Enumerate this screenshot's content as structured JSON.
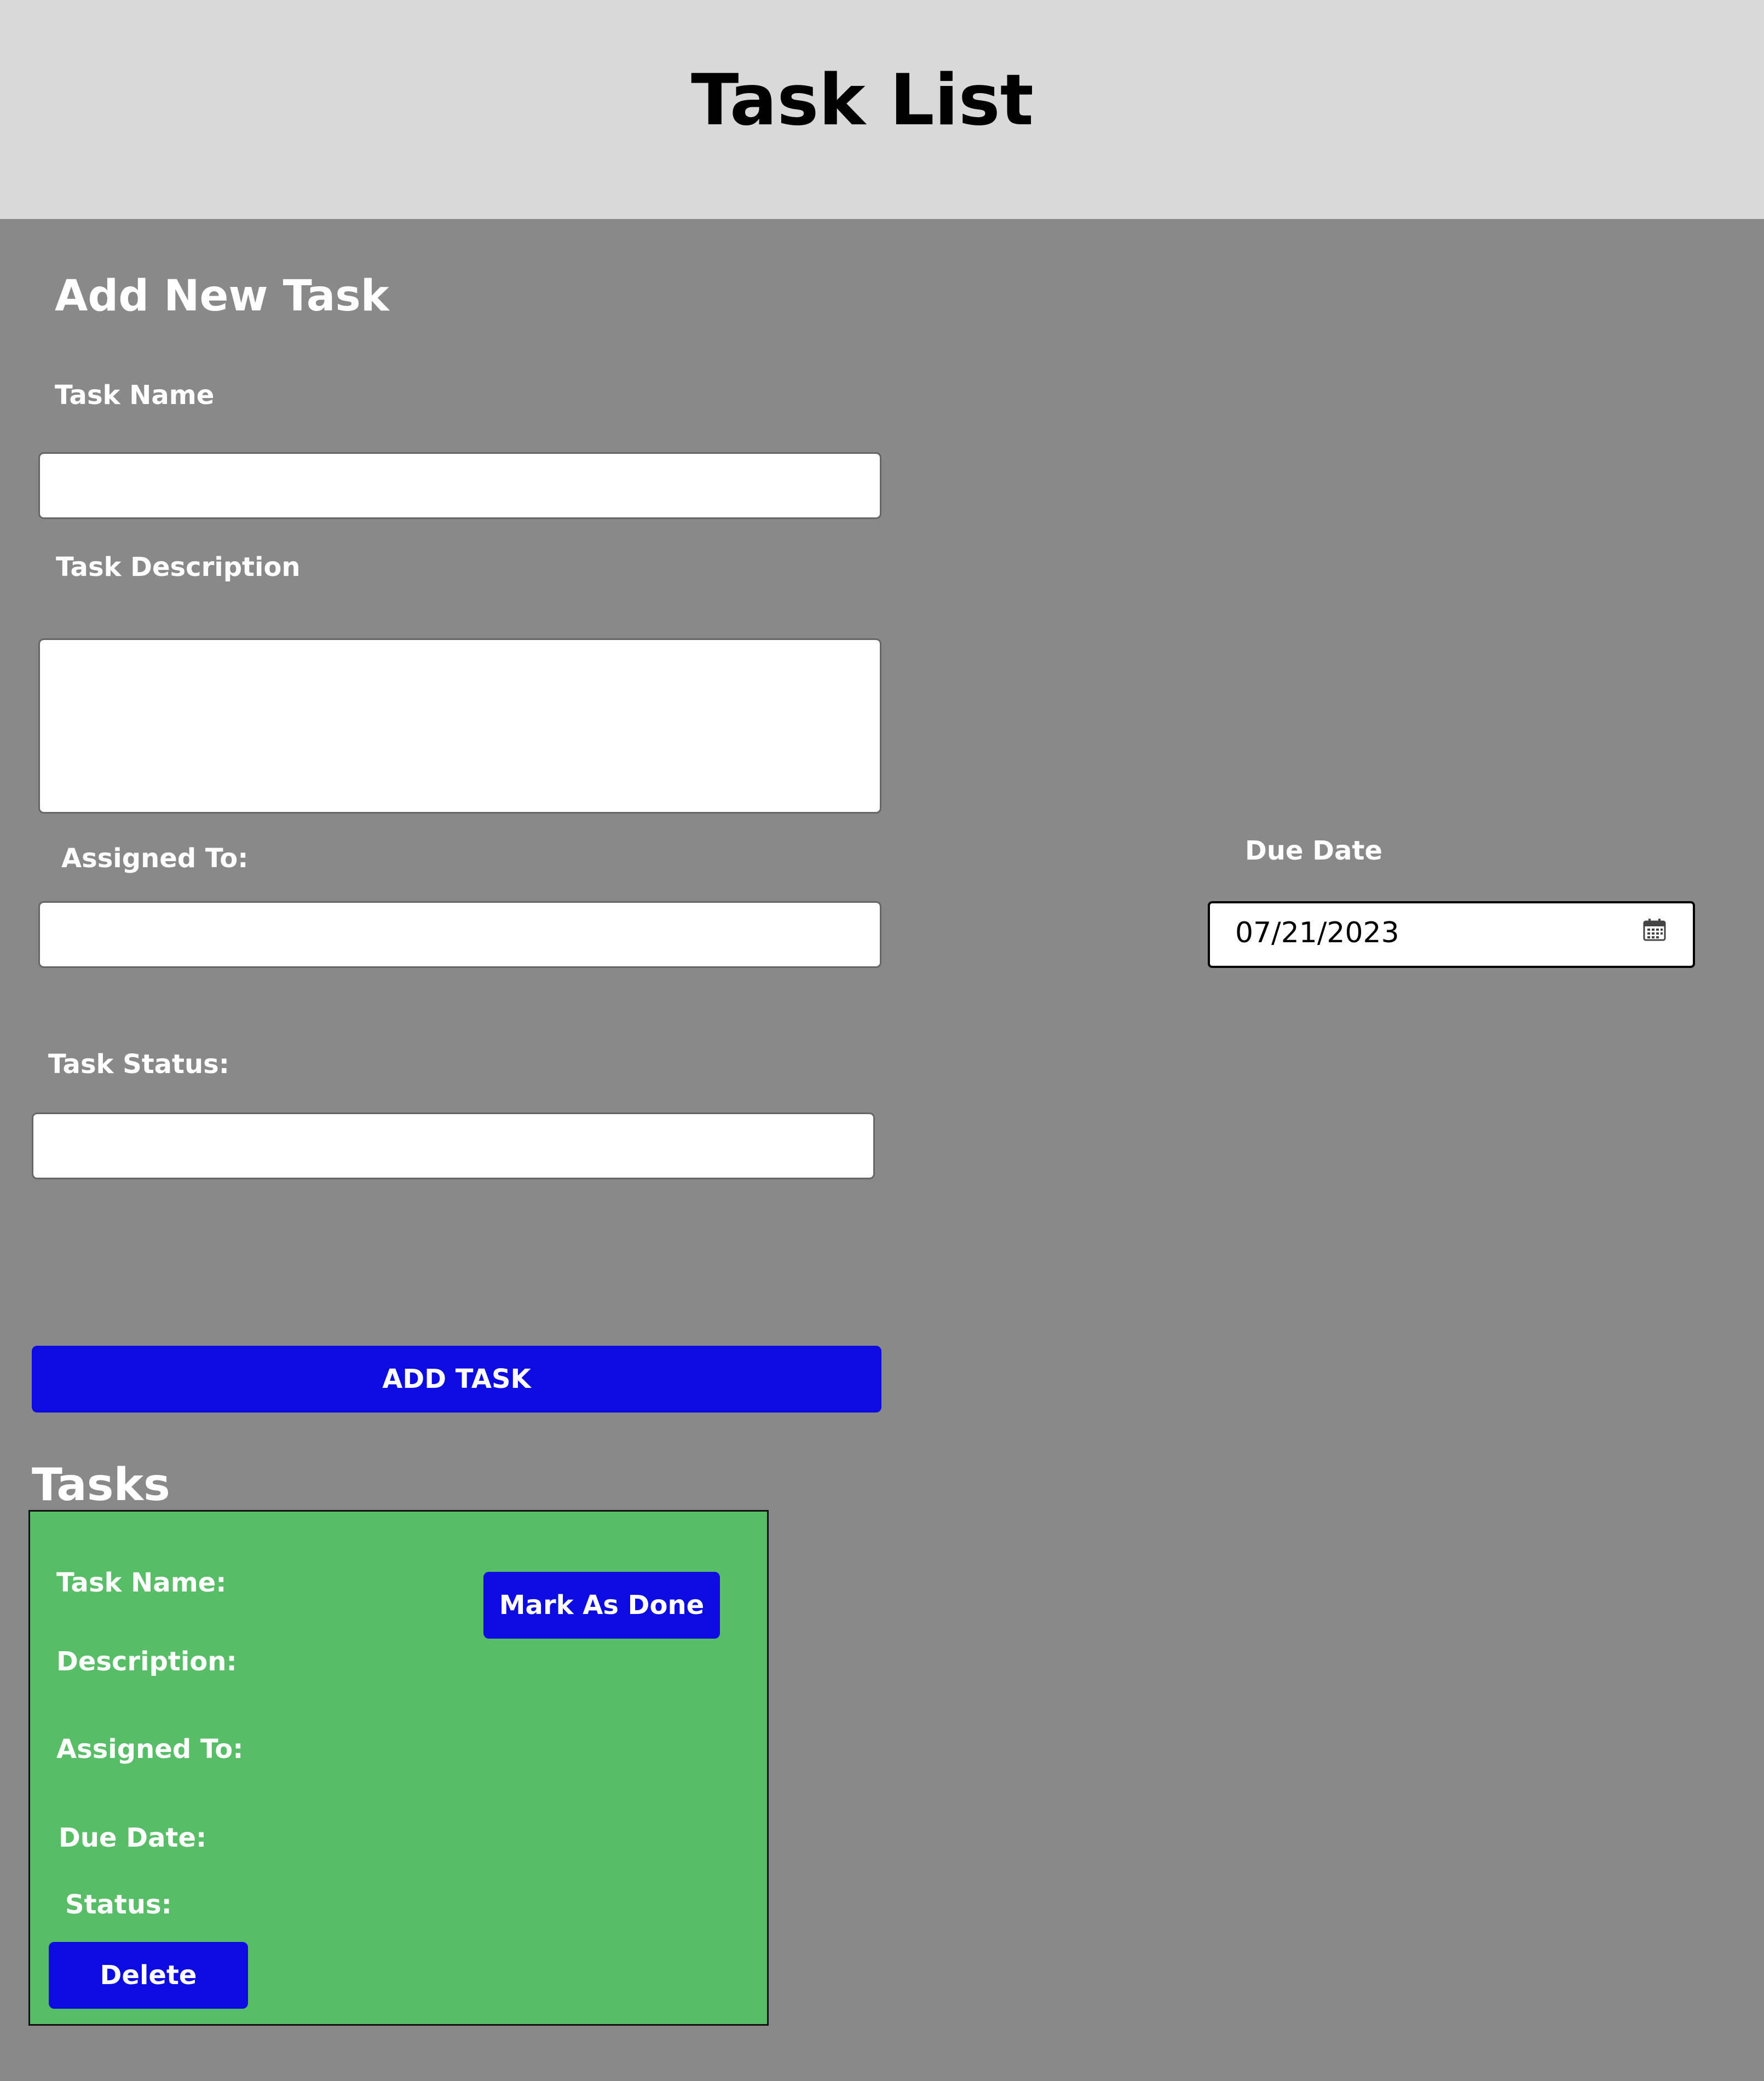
{
  "header": {
    "title": "Task List"
  },
  "form": {
    "title": "Add New Task",
    "task_name_label": "Task Name",
    "task_name_value": "",
    "task_description_label": "Task Description",
    "task_description_value": "",
    "assigned_to_label": "Assigned To:",
    "assigned_to_value": "",
    "due_date_label": "Due Date",
    "due_date_value": "07/21/2023",
    "task_status_label": "Task Status:",
    "task_status_value": "",
    "add_button": "ADD TASK"
  },
  "tasks": {
    "title": "Tasks",
    "card": {
      "task_name_label": "Task Name:",
      "description_label": "Description:",
      "assigned_to_label": "Assigned To:",
      "due_date_label": "Due Date:",
      "status_label": "Status:",
      "mark_done_button": "Mark As Done",
      "delete_button": "Delete",
      "background_color": "#57bd67"
    }
  },
  "colors": {
    "page_background": "#898989",
    "header_background": "#d9d9d9",
    "button_color": "#0c0ce2"
  },
  "icons": {
    "calendar": "calendar-icon"
  }
}
